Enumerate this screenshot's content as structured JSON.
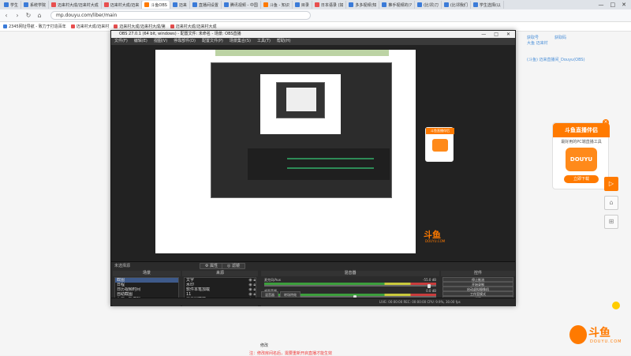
{
  "browser": {
    "tabs": [
      {
        "label": "学生",
        "color": "#3b7bd8"
      },
      {
        "label": "系统学院",
        "color": "#3b7bd8"
      },
      {
        "label": "迈来村大成/迈来村大成",
        "color": "#e84f4f"
      },
      {
        "label": "迈来村大成/迈来",
        "color": "#e84f4f"
      },
      {
        "label": "斗鱼OBS",
        "color": "#ff7a00"
      },
      {
        "label": "迈来",
        "color": "#3b7bd8"
      },
      {
        "label": "直播间设置",
        "color": "#3b7bd8"
      },
      {
        "label": "腾讯视频 - 中国",
        "color": "#3b7bd8"
      },
      {
        "label": "斗鱼 - 知识",
        "color": "#ff7a00"
      },
      {
        "label": "目录",
        "color": "#3b7bd8"
      },
      {
        "label": "日本语录 (如",
        "color": "#e84f4f"
      },
      {
        "label": "多多视频(知",
        "color": "#3b7bd8"
      },
      {
        "label": "推手视频的(?",
        "color": "#3b7bd8"
      },
      {
        "label": "(比邻)刀",
        "color": "#3b7bd8"
      },
      {
        "label": "(比邻我们",
        "color": "#3b7bd8"
      },
      {
        "label": "学生选择(以",
        "color": "#3b7bd8"
      }
    ],
    "window_controls": [
      "—",
      "□",
      "✕"
    ],
    "address": "mp.douyu.com/liber/main",
    "bookmarks": [
      "2345网址导航 - 致力于打造百年",
      "迈来村大成/迈来村",
      "迈来村大成/迈来村大成/第",
      "迈来村大成/迈来村大成"
    ]
  },
  "page": {
    "right_links": [
      "获取号",
      "大鱼  迈来村",
      "(斗鱼)  迈来直播间_Douyu(OBS)"
    ],
    "right_link_extra": "获取码",
    "ad": {
      "banner": "斗鱼直播伴侣",
      "subtitle": "最好用的PC端直播工具",
      "logo_text": "DOUYU",
      "button": "立即下载",
      "close": "×"
    },
    "side_buttons": {
      "play": "▷",
      "home": "⌂",
      "gift": "⊞"
    },
    "logo": {
      "text": "斗鱼",
      "sub": "DOUYU.COM"
    },
    "bottom_text": "修改",
    "bottom_red": "注：修改房间名后，需要重新开启直播才能生效"
  },
  "obs": {
    "title": "OBS 27.0.1 (64 bit, windows) - 配置文件: 未命名 - 场景: OBS直播",
    "window_controls": [
      "—",
      "□",
      "✕"
    ],
    "menu": [
      "文件(F)",
      "编辑(E)",
      "视图(V)",
      "停靠部件(D)",
      "配置文件(P)",
      "场景集合(S)",
      "工具(T)",
      "帮助(H)"
    ],
    "scene_label": "未选择源",
    "btn_properties": "⚙ 属性",
    "btn_filters": "◎ 滤镜",
    "docks": {
      "scenes": {
        "title": "场景",
        "items": [
          "截图",
          "日程",
          "日历视频时间",
          "自助截图",
          "入画一段游戏",
          "点击中间"
        ],
        "selected": 0
      },
      "sources": {
        "title": "来源",
        "items": [
          "文字",
          "水印",
          "软件本笔加载",
          "11",
          "显示器捕获"
        ]
      },
      "mixer": {
        "title": "混音器",
        "channels": [
          {
            "name": "麦克风/Aux",
            "level": "-55.0 dB",
            "fill": 0.95
          },
          {
            "name": "桌面音频",
            "level": "0.0 dB",
            "fill": 0.52
          }
        ],
        "tabs": [
          "混音器",
          "转场特效"
        ]
      },
      "controls": {
        "title": "控件",
        "buttons": [
          "停止推流",
          "开始录制",
          "启动虚拟摄像机",
          "工作室模式",
          "设置",
          "退出"
        ]
      }
    },
    "status": "LIVE: 00:00:00    REC: 00:00:00    CPU: 9.9%, 30.00 fps"
  }
}
